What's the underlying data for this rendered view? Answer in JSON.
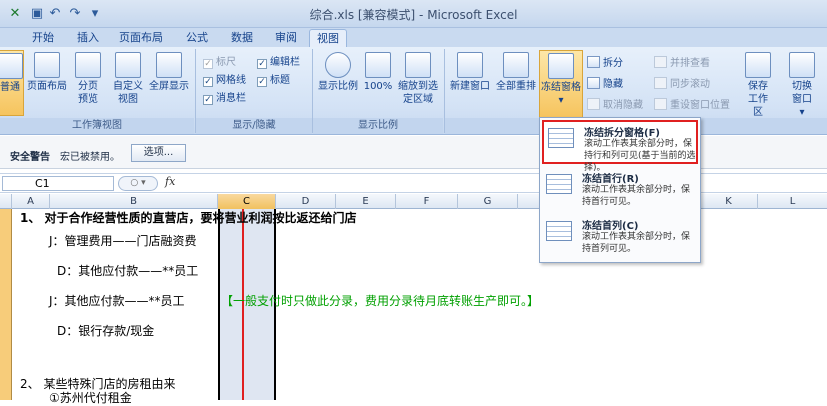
{
  "window": {
    "title": "综合.xls [兼容模式] - Microsoft Excel"
  },
  "tabs": [
    "开始",
    "插入",
    "页面布局",
    "公式",
    "数据",
    "审阅",
    "视图"
  ],
  "ribbon": {
    "workbook_views": {
      "label": "工作簿视图",
      "buttons": [
        "普通",
        "页面布局",
        "分页预览",
        "自定义视图",
        "全屏显示"
      ]
    },
    "show_hide": {
      "label": "显示/隐藏",
      "items": [
        {
          "label": "标尺",
          "checked": true,
          "disabled": true
        },
        {
          "label": "编辑栏",
          "checked": true,
          "disabled": false
        },
        {
          "label": "网格线",
          "checked": true,
          "disabled": false
        },
        {
          "label": "标题",
          "checked": true,
          "disabled": false
        },
        {
          "label": "消息栏",
          "checked": true,
          "disabled": false
        }
      ]
    },
    "zoom": {
      "label": "显示比例",
      "buttons": [
        "显示比例",
        "100%",
        "缩放到选定区域"
      ]
    },
    "window": {
      "buttons": [
        "新建窗口",
        "全部重排",
        "冻结窗格"
      ],
      "small": [
        {
          "label": "拆分",
          "disabled": false
        },
        {
          "label": "隐藏",
          "disabled": false
        },
        {
          "label": "取消隐藏",
          "disabled": true
        },
        {
          "label": "并排查看",
          "disabled": true
        },
        {
          "label": "同步滚动",
          "disabled": true
        },
        {
          "label": "重设窗口位置",
          "disabled": true
        }
      ],
      "save_workspace": "保存工作区",
      "switch_window": "切换窗口"
    }
  },
  "security": {
    "warning": "安全警告",
    "message": "宏已被禁用。",
    "options_button": "选项..."
  },
  "formula_bar": {
    "name_box": "C1",
    "fx": "fx",
    "value": ""
  },
  "columns": [
    "A",
    "B",
    "C",
    "D",
    "E",
    "F",
    "G",
    "K",
    "L"
  ],
  "cells": {
    "r1": "1、   对于合作经营性质的直营店，要将营业利润按比返还给门店",
    "r2": "J：管理费用——门店融资费",
    "r3": "D：其他应付款——**员工",
    "r4a": "J：其他应付款——**员工",
    "r4b": "【一般支付时只做此分录，费用分录待月底转账生产即可。】",
    "r5": "D：银行存款/现金",
    "r6": "2、   某些特殊门店的房租由来",
    "r7": "①苏州代付租金"
  },
  "freeze_menu": {
    "items": [
      {
        "title": "冻结拆分窗格(F)",
        "desc": "滚动工作表其余部分时，保持行和列可见(基于当前的选择)。"
      },
      {
        "title": "冻结首行(R)",
        "desc": "滚动工作表其余部分时，保持首行可见。"
      },
      {
        "title": "冻结首列(C)",
        "desc": "滚动工作表其余部分时，保持首列可见。"
      }
    ]
  },
  "colors": {
    "accent": "#15428b",
    "highlight": "#f6c45e",
    "red_marker": "#e02020",
    "green_text": "#00a000"
  }
}
